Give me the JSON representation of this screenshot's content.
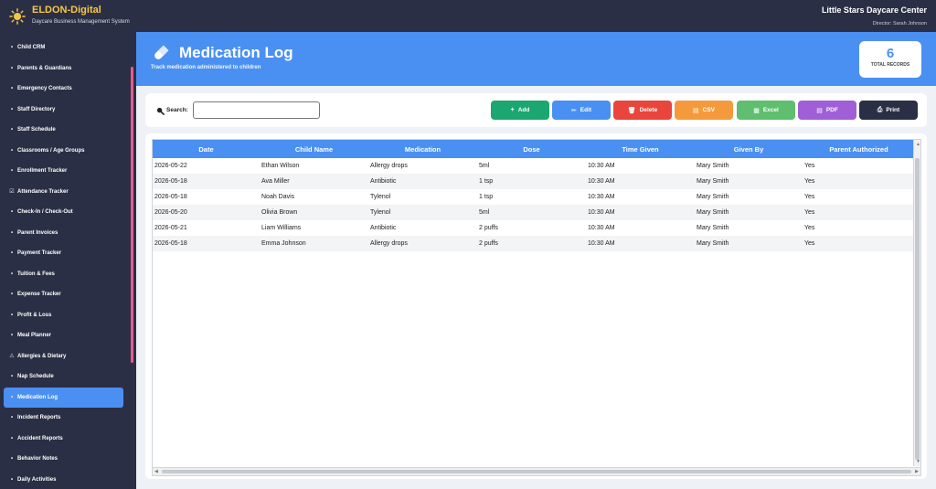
{
  "app": {
    "brand_name": "ELDON-Digital",
    "brand_tagline": "Daycare Business Management System",
    "center_name": "Little Stars Daycare Center",
    "director": "Director: Sarah Johnson",
    "logo_icon": "sun-icon",
    "brand_color": "#f6c744"
  },
  "sidebar": {
    "items": [
      {
        "label": "Child CRM",
        "icon": "•"
      },
      {
        "label": "Parents & Guardians",
        "icon": "•"
      },
      {
        "label": "Emergency Contacts",
        "icon": "•"
      },
      {
        "label": "Staff Directory",
        "icon": "•"
      },
      {
        "label": "Staff Schedule",
        "icon": "•"
      },
      {
        "label": "Classrooms / Age Groups",
        "icon": "•"
      },
      {
        "label": "Enrollment Tracker",
        "icon": "•"
      },
      {
        "label": "Attendance Tracker",
        "icon": "☑"
      },
      {
        "label": "Check-In / Check-Out",
        "icon": "•"
      },
      {
        "label": "Parent Invoices",
        "icon": "•"
      },
      {
        "label": "Payment Tracker",
        "icon": "•"
      },
      {
        "label": "Tuition & Fees",
        "icon": "•"
      },
      {
        "label": "Expense Tracker",
        "icon": "•"
      },
      {
        "label": "Profit & Loss",
        "icon": "•"
      },
      {
        "label": "Meal Planner",
        "icon": "•"
      },
      {
        "label": "Allergies & Dietary",
        "icon": "⚠"
      },
      {
        "label": "Nap Schedule",
        "icon": "•"
      },
      {
        "label": "Medication Log",
        "icon": "•",
        "active": true
      },
      {
        "label": "Incident Reports",
        "icon": "•"
      },
      {
        "label": "Accident Reports",
        "icon": "•"
      },
      {
        "label": "Behavior Notes",
        "icon": "•"
      },
      {
        "label": "Daily Activities",
        "icon": "•"
      }
    ]
  },
  "header": {
    "title": "Medication Log",
    "subtitle": "Track medication administered to children",
    "title_icon": "pill-icon",
    "total_records_value": "6",
    "total_records_label": "TOTAL RECORDS",
    "accent": "#4a90f2"
  },
  "toolbar": {
    "search_label": "Search:",
    "search_value": "",
    "buttons": [
      {
        "key": "add",
        "label": "Add",
        "icon": "+",
        "color": "#1ba672"
      },
      {
        "key": "edit",
        "label": "Edit",
        "icon": "✏",
        "color": "#4a90f2"
      },
      {
        "key": "delete",
        "label": "Delete",
        "icon": "🗑",
        "color": "#e8453c"
      },
      {
        "key": "csv",
        "label": "CSV",
        "icon": "▤",
        "color": "#f59a3c"
      },
      {
        "key": "excel",
        "label": "Excel",
        "icon": "▦",
        "color": "#5fbf6e"
      },
      {
        "key": "pdf",
        "label": "PDF",
        "icon": "▤",
        "color": "#a05fd6"
      },
      {
        "key": "print",
        "label": "Print",
        "icon": "⎙",
        "color": "#2b2f45"
      }
    ]
  },
  "table": {
    "columns": [
      "Date",
      "Child Name",
      "Medication",
      "Dose",
      "Time Given",
      "Given By",
      "Parent Authorized"
    ],
    "rows": [
      [
        "2026-05-22",
        "Ethan Wilson",
        "Allergy drops",
        "5ml",
        "10:30 AM",
        "Mary Smith",
        "Yes"
      ],
      [
        "2026-05-18",
        "Ava Miller",
        "Antibiotic",
        "1 tsp",
        "10:30 AM",
        "Mary Smith",
        "Yes"
      ],
      [
        "2026-05-18",
        "Noah Davis",
        "Tylenol",
        "1 tsp",
        "10:30 AM",
        "Mary Smith",
        "Yes"
      ],
      [
        "2026-05-20",
        "Olivia Brown",
        "Tylenol",
        "5ml",
        "10:30 AM",
        "Mary Smith",
        "Yes"
      ],
      [
        "2026-05-21",
        "Liam Williams",
        "Antibiotic",
        "2 puffs",
        "10:30 AM",
        "Mary Smith",
        "Yes"
      ],
      [
        "2026-05-18",
        "Emma Johnson",
        "Allergy drops",
        "2 puffs",
        "10:30 AM",
        "Mary Smith",
        "Yes"
      ]
    ]
  }
}
